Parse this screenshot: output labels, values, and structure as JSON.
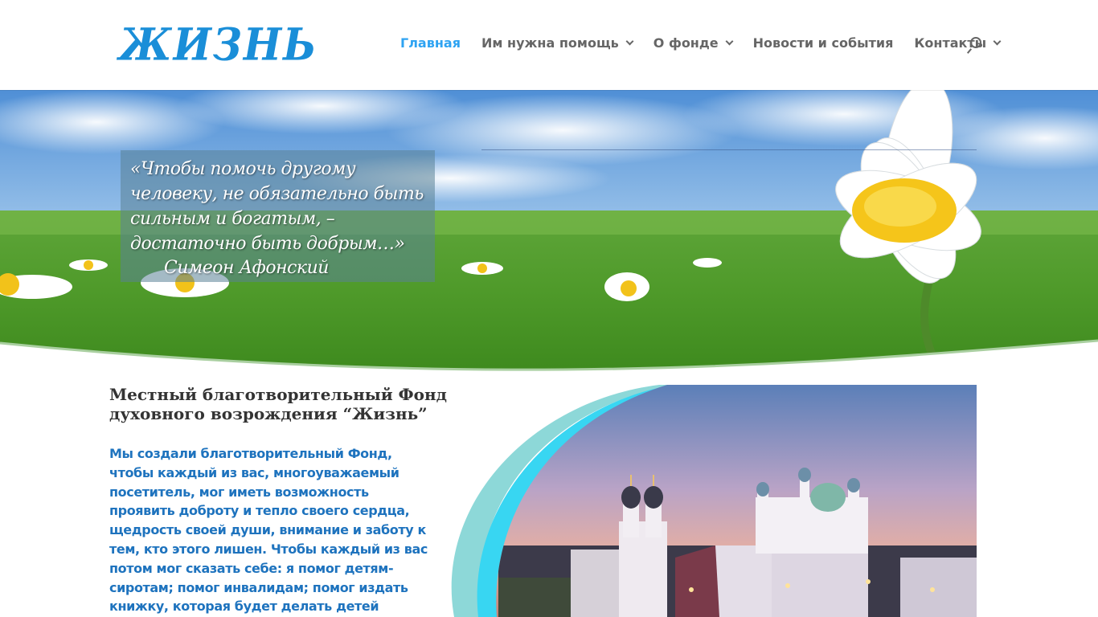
{
  "header": {
    "logo_text": "ЖИЗНЬ",
    "nav": [
      {
        "label": "Главная",
        "active": true,
        "dropdown": false
      },
      {
        "label": "Им нужна помощь",
        "active": false,
        "dropdown": true
      },
      {
        "label": "О фонде",
        "active": false,
        "dropdown": true
      },
      {
        "label": "Новости и события",
        "active": false,
        "dropdown": false
      },
      {
        "label": "Контакты",
        "active": false,
        "dropdown": true
      }
    ],
    "search_icon": "search-icon"
  },
  "hero": {
    "quote": "«Чтобы помочь другому человеку, не обязательно быть сильным и богатым, – достаточно быть добрым…»",
    "author": "Симеон Афонский"
  },
  "content": {
    "title": "Местный благотворительный Фонд духовного возрождения “Жизнь”",
    "body": "Мы создали благотворительный Фонд, чтобы каждый из вас, многоуважаемый посетитель, мог иметь возможность проявить доброту и тепло своего сердца, щедрость своей души, внимание и заботу к тем, кто этого лишен. Чтобы каждый из вас потом мог сказать себе: я помог детям-сиротам; помог инвалидам; помог издать книжку, которая будет делать детей лучше, добрее и благороднее; помог в"
  },
  "colors": {
    "accent": "#2ea3f2",
    "logo": "#1a8ed8",
    "body_text": "#1e73be",
    "nav_text": "#666666"
  }
}
